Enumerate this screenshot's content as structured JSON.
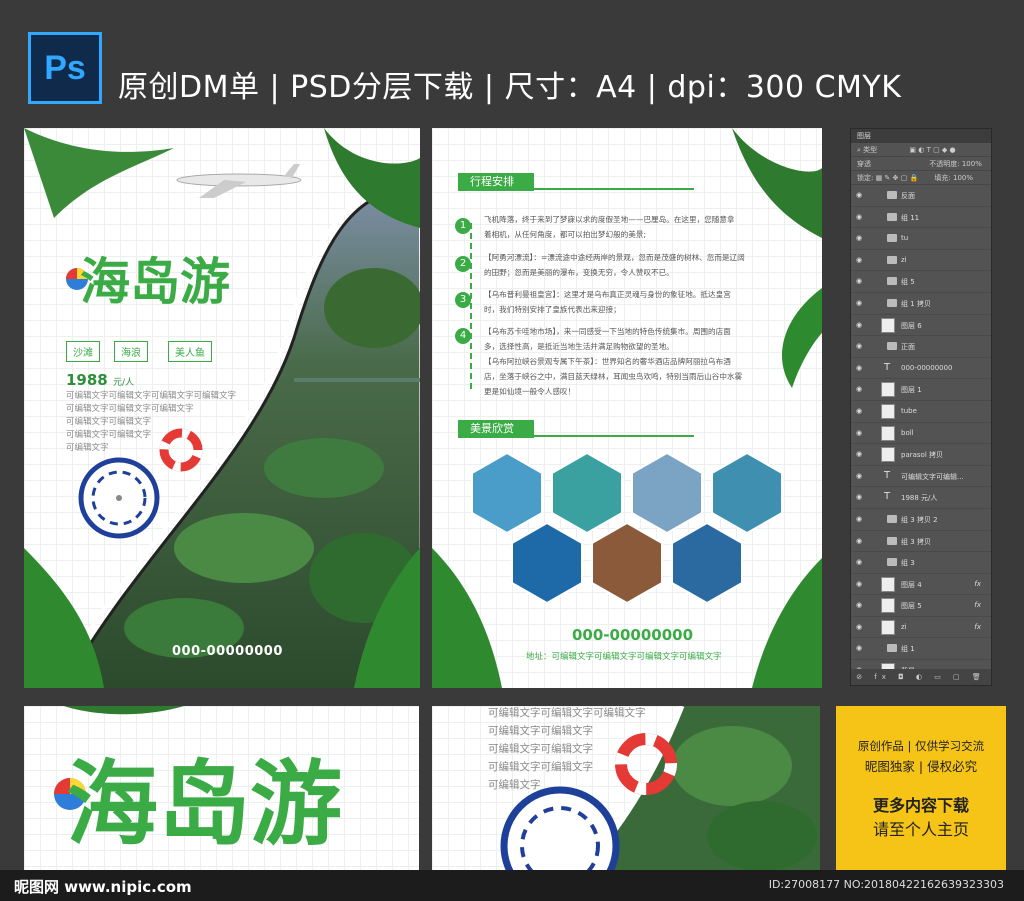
{
  "header": {
    "logo": "Ps",
    "title": "原创DM单 | PSD分层下载 | 尺寸：A4 | dpi：300   CMYK"
  },
  "front": {
    "title": "海岛游",
    "tags": [
      "沙滩",
      "海浪",
      "美人鱼"
    ],
    "price": "1988",
    "price_unit": "元/人",
    "filler": [
      "可编辑文字可编辑文字可编辑文字可编辑文字",
      "可编辑文字可编辑文字可编辑文字",
      "可编辑文字可编辑文字",
      "可编辑文字可编辑文字",
      "可编辑文字"
    ],
    "phone": "000-00000000"
  },
  "back": {
    "section1": "行程安排",
    "steps": [
      "1",
      "2",
      "3",
      "4"
    ],
    "paragraphs": [
      "飞机降落，终于来到了梦寐以求的度假圣地——巴厘岛。在这里，您随意拿",
      "着相机，从任何角度，都可以拍出梦幻般的美景;",
      "【阿勇河漂流】：=漂流途中途经两岸的景观，忽而是茂盛的树林、忽而是辽阔",
      "的田野；忽而是美丽的瀑布，变换无穷，令人赞叹不已。",
      "【乌布普利曼祖皇宫】：这里才是乌布真正灵魂与身份的象征地。抵达皇宫",
      "时，我们特别安排了皇族代表出来迎接；",
      "【乌布苏卡哇地市场】，来一同感受一下当地的特色传统集市。周围的店面",
      "多，选择性高，是抵近当地生活并满足购物欲望的圣地。",
      "【乌布阿拉峡谷景观专属下午茶】：世界知名的奢华酒店品牌阿丽拉乌布酒",
      "店，坐落于峡谷之中，满目蓝天绿林，耳闻虫鸟欢鸣，特别当雨后山谷中水雾",
      "更是如仙境一般令人感叹！"
    ],
    "section2": "美景欣赏",
    "phone": "000-00000000",
    "address": "地址：可编辑文字可编辑文字可编辑文字可编辑文字"
  },
  "layers_panel": {
    "tab": "图层",
    "kind_filter": "类型",
    "blend_mode": "穿透",
    "opacity_label": "不透明度:",
    "opacity_value": "100%",
    "lock_label": "锁定:",
    "fill_label": "填充:",
    "fill_value": "100%",
    "footer_icons": "⊘ fx ◘ ◐ ▭ ▢ 🗑",
    "rows": [
      {
        "name": "反面",
        "kind": "folder"
      },
      {
        "name": "组 11",
        "kind": "folder"
      },
      {
        "name": "tu",
        "kind": "folder"
      },
      {
        "name": "zi",
        "kind": "folder"
      },
      {
        "name": "组 5",
        "kind": "folder"
      },
      {
        "name": "组 1 拷贝",
        "kind": "folder"
      },
      {
        "name": "图层 6",
        "kind": "pixel"
      },
      {
        "name": "正面",
        "kind": "folder"
      },
      {
        "name": "000-00000000",
        "kind": "text"
      },
      {
        "name": "图层 1",
        "kind": "pixel"
      },
      {
        "name": "tube",
        "kind": "pixel"
      },
      {
        "name": "boll",
        "kind": "pixel"
      },
      {
        "name": "parasol 拷贝",
        "kind": "pixel"
      },
      {
        "name": "可编辑文字可编辑...",
        "kind": "text"
      },
      {
        "name": "1988 元/人",
        "kind": "text"
      },
      {
        "name": "组 3 拷贝 2",
        "kind": "folder"
      },
      {
        "name": "组 3 拷贝",
        "kind": "folder"
      },
      {
        "name": "组 3",
        "kind": "folder"
      },
      {
        "name": "图层 4",
        "kind": "pixel",
        "fx": "fx"
      },
      {
        "name": "图层 5",
        "kind": "pixel",
        "fx": "fx"
      },
      {
        "name": "zi",
        "kind": "pixel",
        "fx": "fx"
      },
      {
        "name": "组 1",
        "kind": "folder"
      },
      {
        "name": "背景",
        "kind": "bg"
      }
    ]
  },
  "preview1": {
    "title": "海岛游"
  },
  "preview2": {
    "filler": [
      "可编辑文字可编辑文字可编辑文字",
      "可编辑文字可编辑文字",
      "可编辑文字可编辑文字",
      "可编辑文字可编辑文字",
      "可编辑文字"
    ]
  },
  "badge": {
    "line1": "原创作品 | 仅供学习交流",
    "line2": "昵图独家 | 侵权必究",
    "line3": "更多内容下载",
    "line4": "请至个人主页"
  },
  "footer": {
    "site": "昵图网 www.nipic.com",
    "id": "ID:27008177 NO:20180422162639323303"
  },
  "colors": {
    "brand_green": "#3bab46",
    "badge_yellow": "#f6c416",
    "ps_blue": "#31a8ff"
  }
}
